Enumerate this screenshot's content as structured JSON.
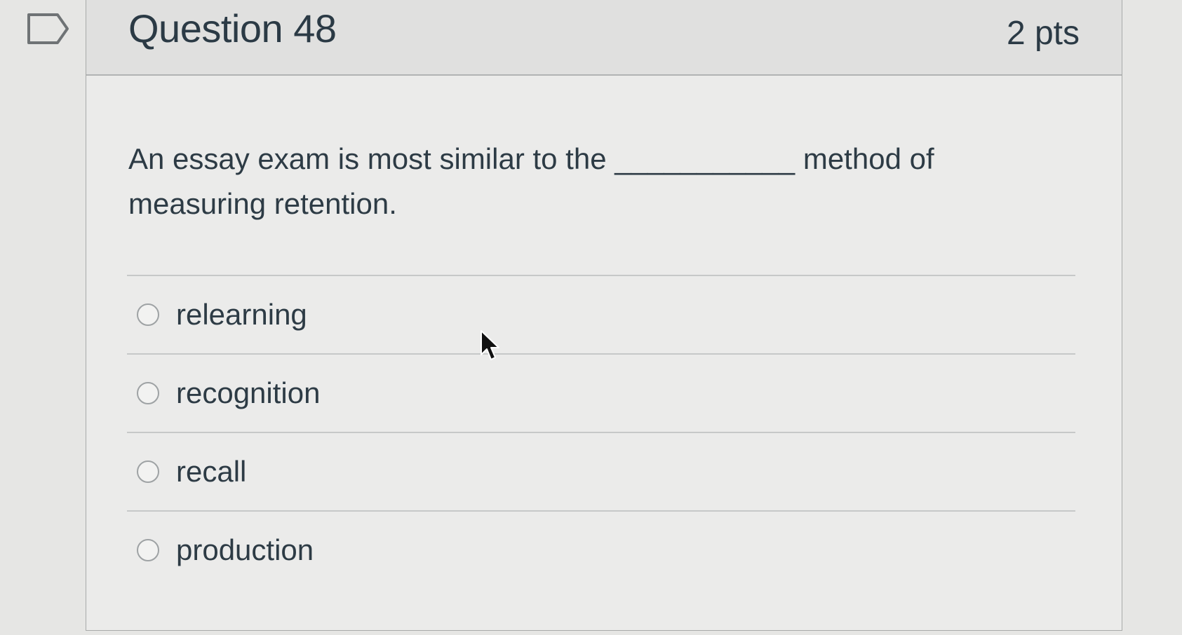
{
  "question": {
    "title": "Question 48",
    "points": "2 pts",
    "text": "An essay exam is most similar to the ___________ method of measuring retention."
  },
  "answers": [
    {
      "label": "relearning",
      "selected": false
    },
    {
      "label": "recognition",
      "selected": false
    },
    {
      "label": "recall",
      "selected": false
    },
    {
      "label": "production",
      "selected": false
    }
  ],
  "icons": {
    "flag": "flag-question-icon",
    "cursor": "mouse-pointer-icon"
  },
  "colors": {
    "text": "#2d3b45",
    "header_bg": "#e0e0df",
    "border": "#a8aaa9"
  }
}
